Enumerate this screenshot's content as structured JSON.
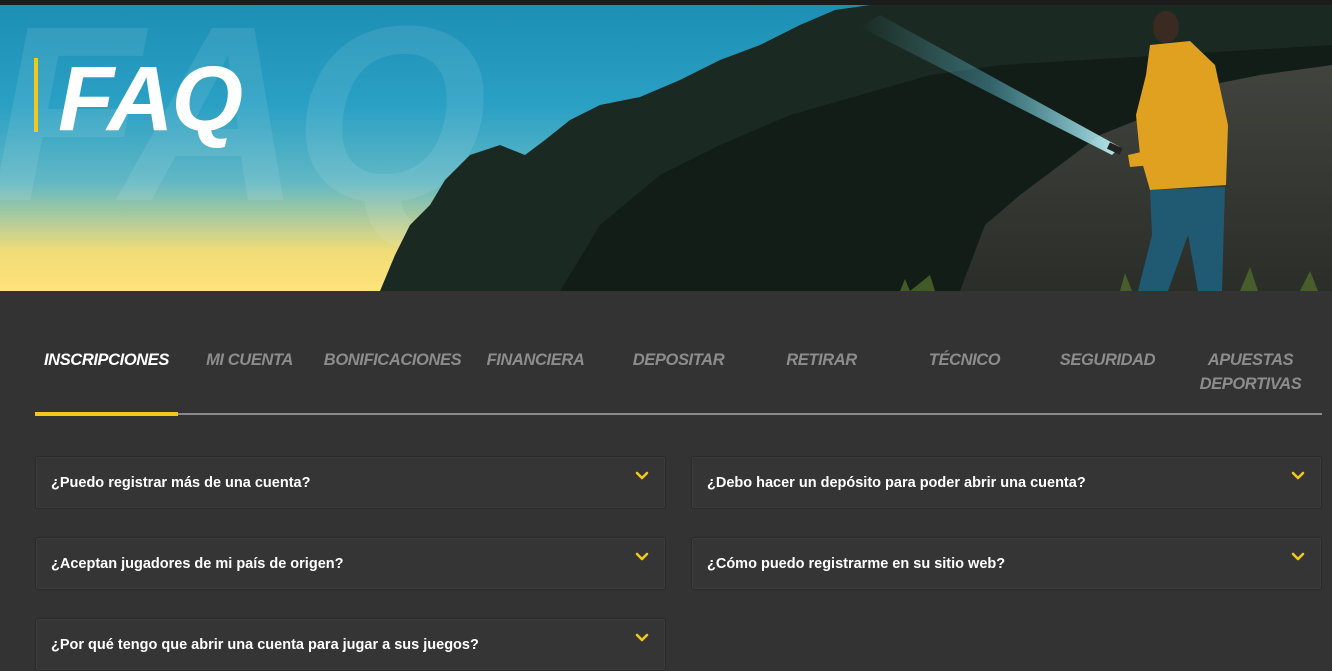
{
  "hero": {
    "title": "FAQ",
    "watermark": "FAQ"
  },
  "tabs": [
    {
      "label": "INSCRIPCIONES",
      "active": true
    },
    {
      "label": "MI CUENTA",
      "active": false
    },
    {
      "label": "BONIFICACIONES",
      "active": false
    },
    {
      "label": "FINANCIERA",
      "active": false
    },
    {
      "label": "DEPOSITAR",
      "active": false
    },
    {
      "label": "RETIRAR",
      "active": false
    },
    {
      "label": "TÉCNICO",
      "active": false
    },
    {
      "label": "SEGURIDAD",
      "active": false
    },
    {
      "label": "APUESTAS DEPORTIVAS",
      "active": false
    }
  ],
  "faq": {
    "left": [
      "¿Puedo registrar más de una cuenta?",
      "¿Aceptan jugadores de mi país de origen?",
      "¿Por qué tengo que abrir una cuenta para jugar a sus juegos?"
    ],
    "right": [
      "¿Debo hacer un depósito para poder abrir una cuenta?",
      "¿Cómo puedo registrarme en su sitio web?"
    ]
  },
  "colors": {
    "accent": "#f2c81d",
    "background": "#333333",
    "tab_inactive": "#8c8c8c",
    "text": "#ffffff"
  },
  "icons": {
    "expand": "chevron-down-icon"
  }
}
